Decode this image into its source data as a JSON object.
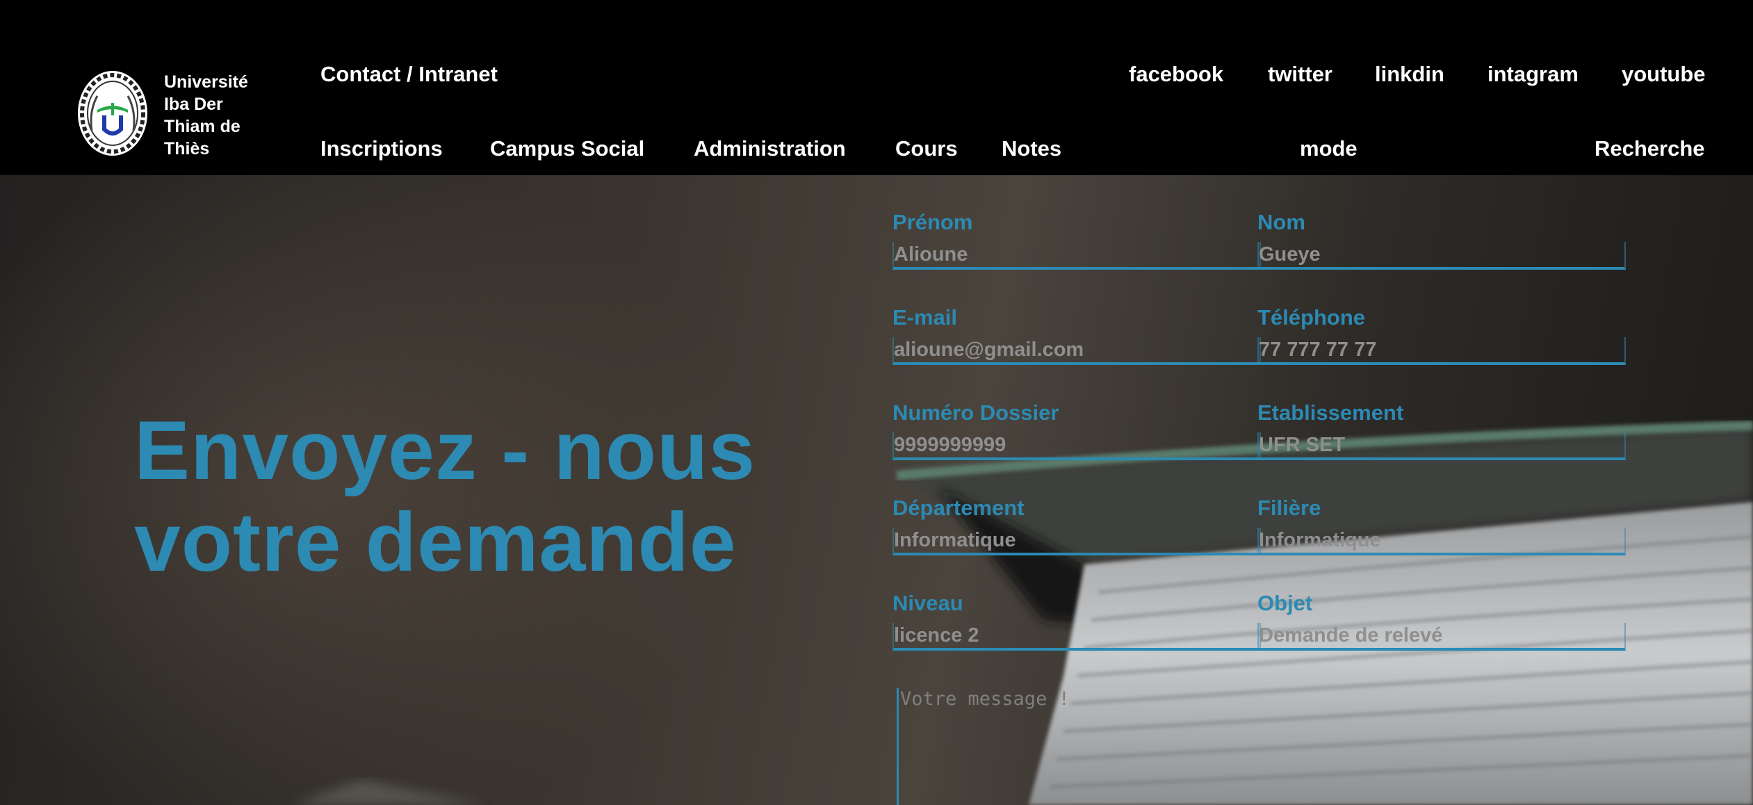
{
  "university": {
    "name_lines": [
      "Université",
      "Iba Der",
      "Thiam de",
      "Thiès"
    ]
  },
  "top_nav": {
    "contact": "Contact / Intranet",
    "social": [
      "facebook",
      "twitter",
      "linkdin",
      "intagram",
      "youtube"
    ]
  },
  "main_nav": {
    "items": [
      "Inscriptions",
      "Campus Social",
      "Administration",
      "Cours",
      "Notes"
    ],
    "mode": "mode",
    "search": "Recherche"
  },
  "hero": {
    "title_lines": [
      "Envoyez - nous",
      "votre demande"
    ]
  },
  "form": {
    "fields": [
      {
        "label": "Prénom",
        "placeholder": "Alioune"
      },
      {
        "label": "Nom",
        "placeholder": "Gueye"
      },
      {
        "label": "E-mail",
        "placeholder": "alioune@gmail.com"
      },
      {
        "label": "Téléphone",
        "placeholder": "77 777 77 77"
      },
      {
        "label": "Numéro Dossier",
        "placeholder": "9999999999"
      },
      {
        "label": "Etablissement",
        "placeholder": "UFR SET"
      },
      {
        "label": "Département",
        "placeholder": "Informatique"
      },
      {
        "label": "Filière",
        "placeholder": "Informatique"
      },
      {
        "label": "Niveau",
        "placeholder": "licence 2"
      },
      {
        "label": "Objet",
        "placeholder": "Demande de relevé"
      }
    ],
    "message_placeholder": "Votre message !"
  },
  "colors": {
    "accent": "#2c8ab3",
    "header_bg": "#000000",
    "placeholder": "#8f8f8f"
  }
}
